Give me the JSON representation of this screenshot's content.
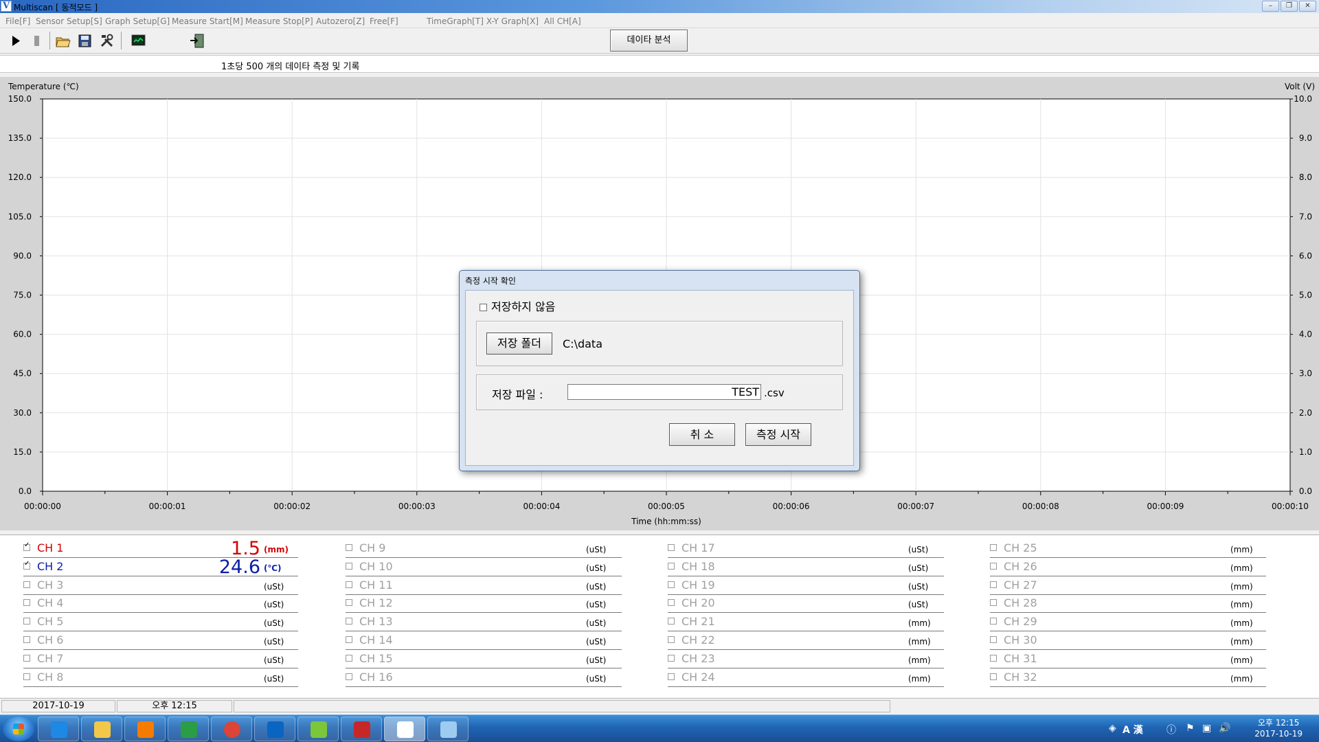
{
  "window": {
    "title": "Multiscan  [ 동적모드 ]",
    "app_icon": "V",
    "controls": [
      "minimize",
      "restore",
      "close"
    ]
  },
  "menu": [
    "File[F]",
    "Sensor Setup[S]",
    "Graph Setup[G]",
    "Measure Start[M]",
    "Measure Stop[P]",
    "Autozero[Z]",
    "Free[F]",
    "TimeGraph[T]",
    "X-Y Graph[X]",
    "All CH[A]"
  ],
  "toolbar": {
    "icons": [
      "play-icon",
      "stop-icon",
      "open-folder-icon",
      "save-disk-icon",
      "tools-icon",
      "monitor-icon",
      "export-icon"
    ],
    "analysis_button": "데이타 분석"
  },
  "info_line": "1초당 500 개의 데이타 측정 및 기록",
  "chart_data": {
    "type": "line",
    "left_axis_label": "Temperature (℃)",
    "right_axis_label": "Volt (V)",
    "xlabel": "Time (hh:mm:ss)",
    "y_left_ticks": [
      "150.0",
      "135.0",
      "120.0",
      "105.0",
      "90.0",
      "75.0",
      "60.0",
      "45.0",
      "30.0",
      "15.0",
      "0.0"
    ],
    "y_right_ticks": [
      "10.0",
      "9.0",
      "8.0",
      "7.0",
      "6.0",
      "5.0",
      "4.0",
      "3.0",
      "2.0",
      "1.0",
      "0.0"
    ],
    "x_ticks": [
      "00:00:00",
      "00:00:01",
      "00:00:02",
      "00:00:03",
      "00:00:04",
      "00:00:05",
      "00:00:06",
      "00:00:07",
      "00:00:08",
      "00:00:09",
      "00:00:10"
    ],
    "ylim_left": [
      0,
      150
    ],
    "ylim_right": [
      0,
      10
    ],
    "xlim_seconds": [
      0,
      10
    ],
    "grid": true,
    "series": []
  },
  "dialog": {
    "title": "측정 시작 확인",
    "no_save_label": "저장하지 않음",
    "no_save_checked": false,
    "folder_button": "저장 폴더",
    "folder_path": "C:\\data",
    "file_label": "저장 파일   :",
    "file_value": "TEST",
    "file_ext": ".csv",
    "cancel_button": "취 소",
    "start_button": "측정 시작"
  },
  "channels": {
    "columns": [
      [
        {
          "label": "CH 1",
          "checked": true,
          "value": "1.5",
          "unit": "(mm)",
          "color": "#d40000"
        },
        {
          "label": "CH 2",
          "checked": true,
          "value": "24.6",
          "unit": "(℃)",
          "color": "#0a1ea8"
        },
        {
          "label": "CH 3",
          "checked": false,
          "value": "",
          "unit": "(uSt)"
        },
        {
          "label": "CH 4",
          "checked": false,
          "value": "",
          "unit": "(uSt)"
        },
        {
          "label": "CH 5",
          "checked": false,
          "value": "",
          "unit": "(uSt)"
        },
        {
          "label": "CH 6",
          "checked": false,
          "value": "",
          "unit": "(uSt)"
        },
        {
          "label": "CH 7",
          "checked": false,
          "value": "",
          "unit": "(uSt)"
        },
        {
          "label": "CH 8",
          "checked": false,
          "value": "",
          "unit": "(uSt)"
        }
      ],
      [
        {
          "label": "CH 9",
          "checked": false,
          "value": "",
          "unit": "(uSt)"
        },
        {
          "label": "CH 10",
          "checked": false,
          "value": "",
          "unit": "(uSt)"
        },
        {
          "label": "CH 11",
          "checked": false,
          "value": "",
          "unit": "(uSt)"
        },
        {
          "label": "CH 12",
          "checked": false,
          "value": "",
          "unit": "(uSt)"
        },
        {
          "label": "CH 13",
          "checked": false,
          "value": "",
          "unit": "(uSt)"
        },
        {
          "label": "CH 14",
          "checked": false,
          "value": "",
          "unit": "(uSt)"
        },
        {
          "label": "CH 15",
          "checked": false,
          "value": "",
          "unit": "(uSt)"
        },
        {
          "label": "CH 16",
          "checked": false,
          "value": "",
          "unit": "(uSt)"
        }
      ],
      [
        {
          "label": "CH 17",
          "checked": false,
          "value": "",
          "unit": "(uSt)"
        },
        {
          "label": "CH 18",
          "checked": false,
          "value": "",
          "unit": "(uSt)"
        },
        {
          "label": "CH 19",
          "checked": false,
          "value": "",
          "unit": "(uSt)"
        },
        {
          "label": "CH 20",
          "checked": false,
          "value": "",
          "unit": "(uSt)"
        },
        {
          "label": "CH 21",
          "checked": false,
          "value": "",
          "unit": "(mm)"
        },
        {
          "label": "CH 22",
          "checked": false,
          "value": "",
          "unit": "(mm)"
        },
        {
          "label": "CH 23",
          "checked": false,
          "value": "",
          "unit": "(mm)"
        },
        {
          "label": "CH 24",
          "checked": false,
          "value": "",
          "unit": "(mm)"
        }
      ],
      [
        {
          "label": "CH 25",
          "checked": false,
          "value": "",
          "unit": "(mm)"
        },
        {
          "label": "CH 26",
          "checked": false,
          "value": "",
          "unit": "(mm)"
        },
        {
          "label": "CH 27",
          "checked": false,
          "value": "",
          "unit": "(mm)"
        },
        {
          "label": "CH 28",
          "checked": false,
          "value": "",
          "unit": "(mm)"
        },
        {
          "label": "CH 29",
          "checked": false,
          "value": "",
          "unit": "(mm)"
        },
        {
          "label": "CH 30",
          "checked": false,
          "value": "",
          "unit": "(mm)"
        },
        {
          "label": "CH 31",
          "checked": false,
          "value": "",
          "unit": "(mm)"
        },
        {
          "label": "CH 32",
          "checked": false,
          "value": "",
          "unit": "(mm)"
        }
      ]
    ]
  },
  "status": {
    "date": "2017-10-19",
    "time": "오후 12:15"
  },
  "taskbar": {
    "apps": [
      "ie-icon",
      "explorer-icon",
      "media-player-icon",
      "map-app-icon",
      "chrome-icon",
      "outlook-icon",
      "green-app-icon",
      "go-app-icon",
      "multiscan-icon",
      "paint-icon"
    ],
    "active_app": "multiscan-icon",
    "tray_lang": "A 漢",
    "clock_time": "오후 12:15",
    "clock_date": "2017-10-19"
  }
}
